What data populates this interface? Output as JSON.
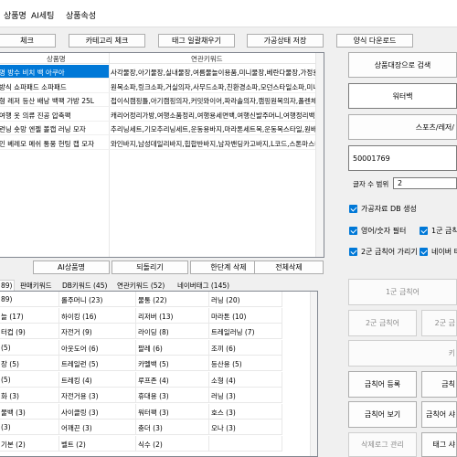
{
  "menu": [
    "상품명",
    "AI세팅",
    "상품속성"
  ],
  "toolbar": [
    "체크",
    "카테고리 체크",
    "태그 일괄채우기",
    "가공상태 저장",
    "양식 다운로드"
  ],
  "table": {
    "headers": [
      "상품명",
      "연관키워드"
    ],
    "rows": [
      {
        "name": "명 방수 비치 백 아쿠아",
        "kw": "사각물장,아기물장,실내물장,여름물놀이용품,미니물장,베란다물장,가정용"
      },
      {
        "name": "방식 쇼파패드 소파패드",
        "kw": "원목소파,링크소파,거실의자,사무드소파,친환경소파,모던스타일소파,미니"
      },
      {
        "name": "형 레저 등산 배낭 백팩 가방 25L",
        "kw": "접이식캠핑틀,아기캠핑의자,커밋와이어,파라솔의자,캠핑원목의자,폴렌체"
      },
      {
        "name": "여행 옷 의류 진공 압축팩",
        "kw": "캐리어정리가방,여행소품정리,여행용세면백,여행신발주머니,여행정리백,"
      },
      {
        "name": "런닝 숏망 엔젤 볼캡 러닝 모자",
        "kw": "추리닝세트,기모추리닝세트,운동용바지,마라톤세트복,운동복스타일,원배"
      },
      {
        "name": "인 베레모 메쉬 통풍 헌팅 캡 모자",
        "kw": "와인바지,남성데일리바지,힙합반바지,남자밴딩카고바지,L코드,스톤마스터"
      }
    ]
  },
  "right": {
    "search_btn": "상품대장으로 검색",
    "field1": "워터백",
    "btn_partial": "스포츠/레저/",
    "field2": "50001769",
    "range_label": "글자 수 범위",
    "range_value": "2",
    "checks": [
      "가공자료 DB 생성",
      "영어/숫자 필터",
      "1군 금칙",
      "2군 금칙어 가리기",
      "네이버 태"
    ],
    "ban1": "1군 금칙어",
    "ban2a": "2군 금칙어",
    "ban2b": "2군 금",
    "kita": "키",
    "ban_register": "금칙어 등록",
    "ban_reg2": "금칙",
    "ban_view": "금칙어 보기",
    "ban_view2": "금칙어 샤",
    "del_log": "삭제로그 관리",
    "tag_btn": "태그 샤"
  },
  "bottom_bar": [
    "AI상품명",
    "되돌리기",
    "한단계 삭제",
    "전체삭제"
  ],
  "tabs": [
    "89)",
    "판매키워드",
    "DB키워드 (45)",
    "연관키워드 (52)",
    "네이버태그 (145)"
  ],
  "kgrid": [
    [
      "89)",
      "롤주머니 (23)",
      "물통 (22)",
      "러닝 (20)"
    ],
    [
      "늘 (17)",
      "하이킹 (16)",
      "리저버 (13)",
      "마라톤 (10)"
    ],
    [
      "터컵 (9)",
      "자전거 (9)",
      "라이딩 (8)",
      "트레일러닝 (7)"
    ],
    [
      "(5)",
      "아웃도어 (6)",
      "팔레 (6)",
      "조끼 (6)"
    ],
    [
      "장 (5)",
      "트레일런 (5)",
      "카멜백 (5)",
      "등산용 (5)"
    ],
    [
      "(5)",
      "트레킹 (4)",
      "루프존 (4)",
      "소형 (4)"
    ],
    [
      "화 (3)",
      "자전거용 (3)",
      "휴대용 (3)",
      "러닝 (3)"
    ],
    [
      "물백 (3)",
      "사이클링 (3)",
      "워터팩 (3)",
      "호스 (3)"
    ],
    [
      "(3)",
      "어깨끈 (3)",
      "충더 (3)",
      "오나 (3)"
    ],
    [
      "기본 (2)",
      "벨트 (2)",
      "식수 (2)",
      ""
    ]
  ]
}
